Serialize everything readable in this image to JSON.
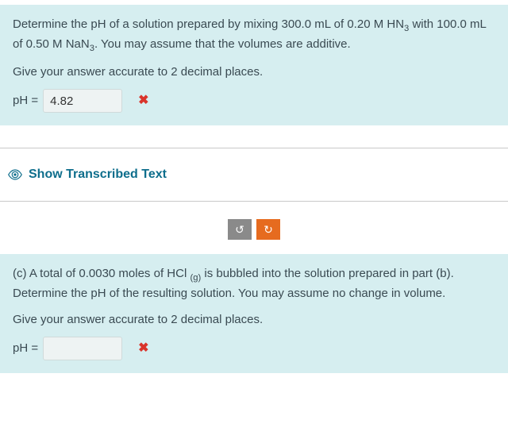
{
  "q1": {
    "para1_pre": "Determine the pH of a solution prepared by mixing 300.0 mL of 0.20 M HN",
    "para1_sub1": "3",
    "para1_mid": " with 100.0 mL of 0.50 M NaN",
    "para1_sub2": "3",
    "para1_post": ". You may assume that the volumes are additive.",
    "para2": "Give your answer accurate to 2 decimal places.",
    "ph_label": "pH =",
    "ph_value": "4.82",
    "wrong": "✖"
  },
  "transcribed": {
    "label": "Show Transcribed Text"
  },
  "refresh": {
    "undo": "↺",
    "redo": "↻"
  },
  "q2": {
    "para1_pre": "(c)  A total of 0.0030 moles of HCl ",
    "para1_sub": "(g)",
    "para1_post": " is bubbled into the solution prepared in part (b).  Determine the pH of the resulting solution.  You may assume no change in volume.",
    "para2": "Give your answer accurate to 2 decimal places.",
    "ph_label": "pH =",
    "ph_value": "",
    "wrong": "✖"
  }
}
